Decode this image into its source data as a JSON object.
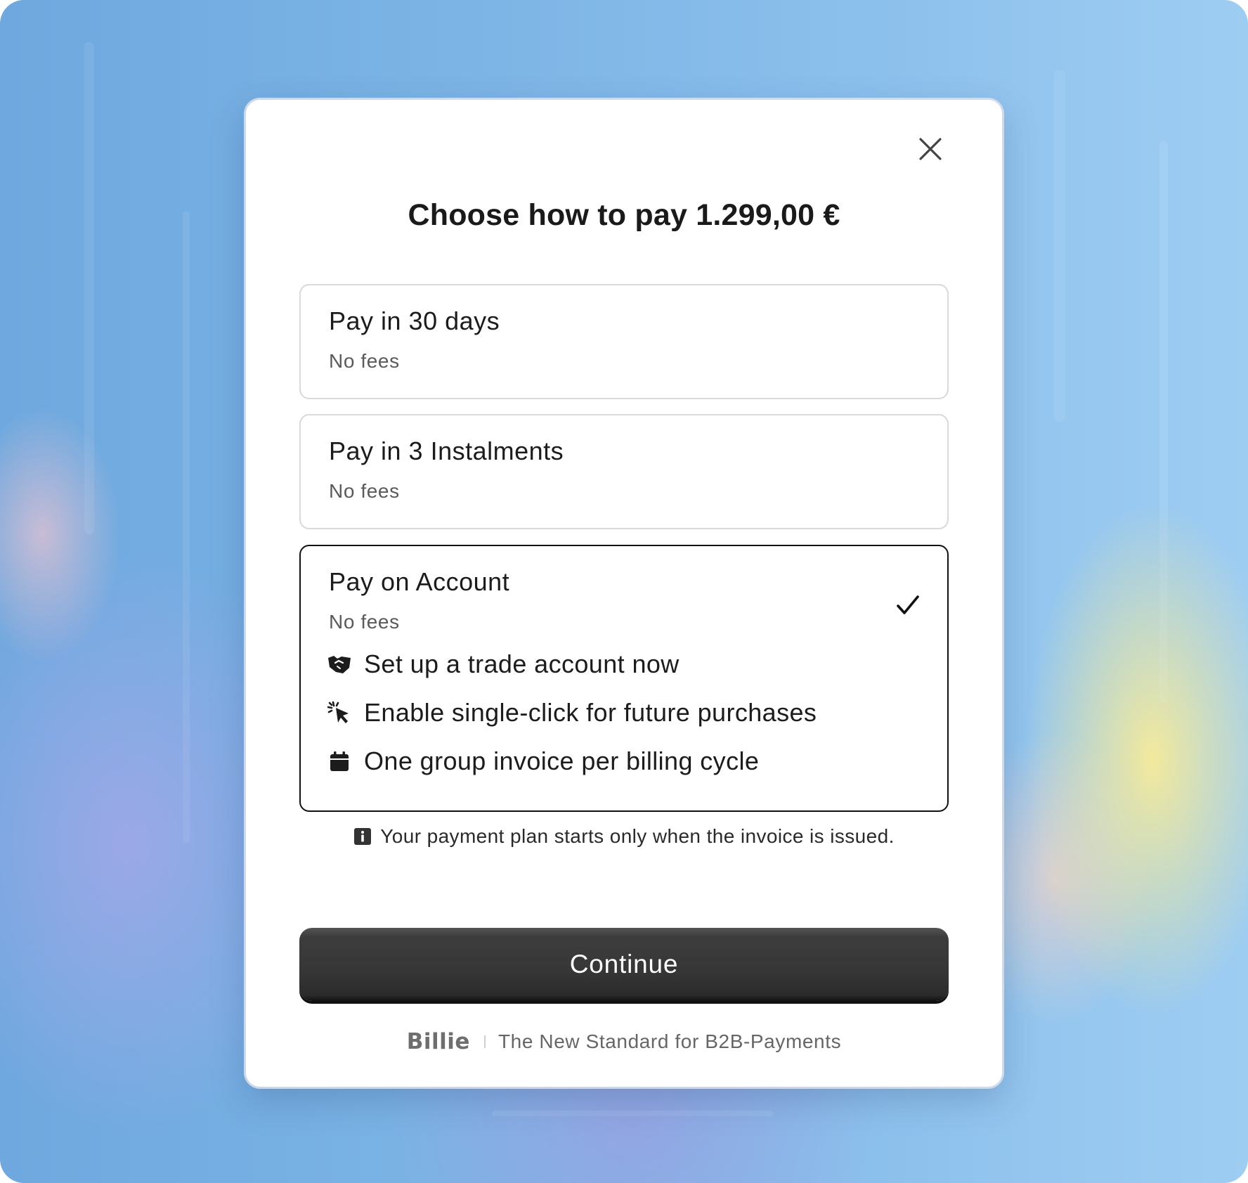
{
  "modal": {
    "title": "Choose how to pay 1.299,00 €",
    "options": [
      {
        "title": "Pay in 30 days",
        "subtitle": "No fees",
        "selected": false
      },
      {
        "title": "Pay in 3 Instalments",
        "subtitle": "No fees",
        "selected": false
      },
      {
        "title": "Pay on Account",
        "subtitle": "No fees",
        "selected": true,
        "benefits": [
          {
            "icon": "handshake-icon",
            "text": "Set up a trade account now"
          },
          {
            "icon": "click-cursor-icon",
            "text": "Enable single-click for future purchases"
          },
          {
            "icon": "calendar-icon",
            "text": "One group invoice per billing cycle"
          }
        ]
      }
    ],
    "note": {
      "icon": "info-icon",
      "text": "Your payment plan starts only when the invoice is issued."
    },
    "continue_label": "Continue",
    "footer": {
      "brand": "Billie",
      "tagline": "The New Standard for B2B-Payments"
    }
  },
  "colors": {
    "selected_border": "#111111",
    "button_bg": "#363636",
    "button_text": "#ffffff"
  }
}
